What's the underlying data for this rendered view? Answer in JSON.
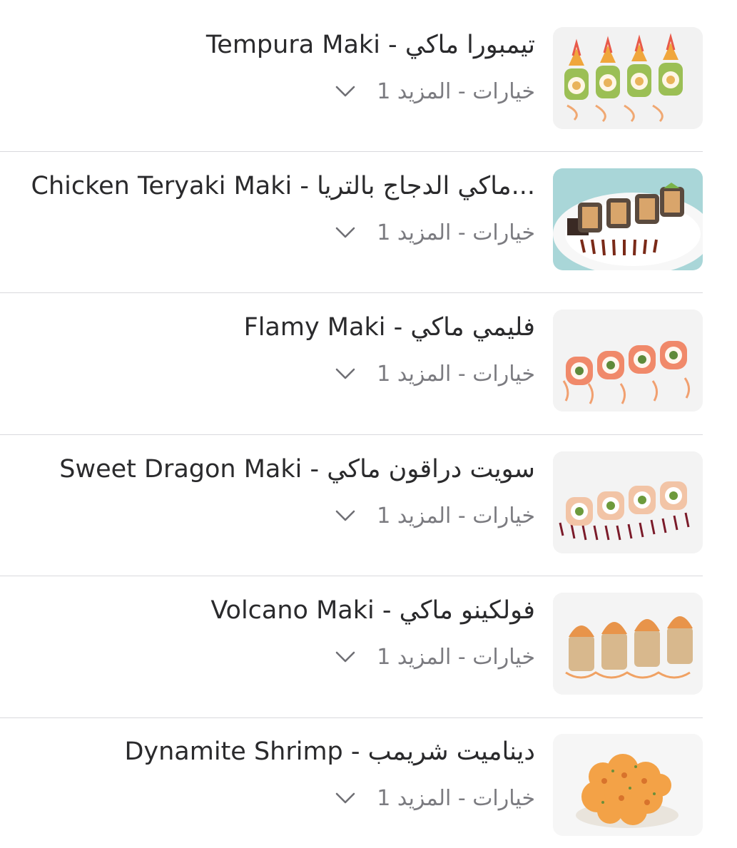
{
  "items": [
    {
      "title": "Tempura Maki - تيمبورا ماكي",
      "options": "1 خيارات - المزيد",
      "image": "tempura-maki-photo"
    },
    {
      "title": "Chicken Teryaki Maki - ماكي الدجاج بالتريا...",
      "options": "1 خيارات - المزيد",
      "image": "chicken-teriyaki-maki-photo"
    },
    {
      "title": "Flamy Maki - فليمي ماكي",
      "options": "1 خيارات - المزيد",
      "image": "flamy-maki-photo"
    },
    {
      "title": "Sweet Dragon Maki - سويت دراقون ماكي",
      "options": "1 خيارات - المزيد",
      "image": "sweet-dragon-maki-photo"
    },
    {
      "title": "Volcano Maki - فولكينو ماكي",
      "options": "1 خيارات - المزيد",
      "image": "volcano-maki-photo"
    },
    {
      "title": "Dynamite Shrimp - ديناميت شريمب",
      "options": "1 خيارات - المزيد",
      "image": "dynamite-shrimp-photo"
    }
  ],
  "icons": {
    "expand": "chevron-down-icon"
  },
  "colors": {
    "title_text": "#2a2a2c",
    "secondary_text": "#7b7b80",
    "divider": "#d9d9dd",
    "background": "#ffffff"
  }
}
